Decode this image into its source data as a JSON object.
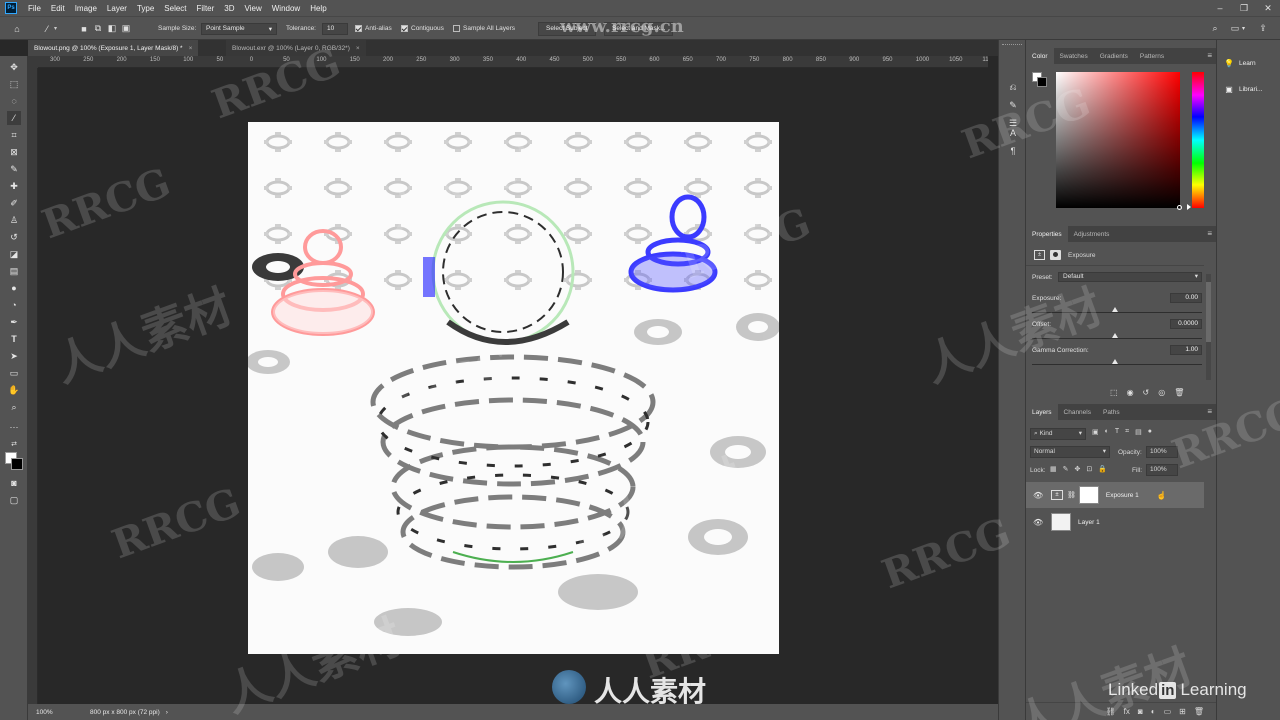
{
  "menubar": {
    "app_icon": "Ps",
    "items": [
      "File",
      "Edit",
      "Image",
      "Layer",
      "Type",
      "Select",
      "Filter",
      "3D",
      "View",
      "Window",
      "Help"
    ],
    "window_controls": [
      "minimize-icon",
      "maximize-icon",
      "close-icon"
    ]
  },
  "options": {
    "sample_size_label": "Sample Size:",
    "sample_size_value": "Point Sample",
    "tolerance_label": "Tolerance:",
    "tolerance_value": "10",
    "anti_alias_label": "Anti-alias",
    "contiguous_label": "Contiguous",
    "sample_all_layers_label": "Sample All Layers",
    "select_subject_label": "Select Subject",
    "select_and_mask_label": "Select and Mask...",
    "watermark_url": "www.rrcg.cn"
  },
  "tabs": [
    {
      "label": "Blowout.png @ 100% (Exposure 1, Layer Mask/8) *"
    },
    {
      "label": "Blowout.exr @ 100% (Layer 0, RGB/32*)"
    }
  ],
  "ruler_ticks": [
    "300",
    "250",
    "200",
    "150",
    "100",
    "50",
    "0",
    "50",
    "100",
    "150",
    "200",
    "250",
    "300",
    "350",
    "400",
    "450",
    "500",
    "550",
    "600",
    "650",
    "700",
    "750",
    "800",
    "850",
    "900",
    "950",
    "1000",
    "1050",
    "1100"
  ],
  "status": {
    "zoom": "100%",
    "doc_info": "800 px x 800 px (72 ppi)"
  },
  "color_panel": {
    "tabs": [
      "Color",
      "Swatches",
      "Gradients",
      "Patterns"
    ]
  },
  "properties_panel": {
    "tabs": [
      "Properties",
      "Adjustments"
    ],
    "adjustment_name": "Exposure",
    "preset_label": "Preset:",
    "preset_value": "Default",
    "exposure_label": "Exposure:",
    "exposure_value": "0.00",
    "offset_label": "Offset:",
    "offset_value": "0.0000",
    "gamma_label": "Gamma Correction:",
    "gamma_value": "1.00"
  },
  "layers_panel": {
    "tabs": [
      "Layers",
      "Channels",
      "Paths"
    ],
    "filter_label": "Kind",
    "blend_mode": "Normal",
    "opacity_label": "Opacity:",
    "opacity_value": "100%",
    "lock_label": "Lock:",
    "fill_label": "Fill:",
    "fill_value": "100%",
    "layers": [
      {
        "name": "Exposure 1",
        "selected": true
      },
      {
        "name": "Layer 1",
        "selected": false
      }
    ]
  },
  "libraries": {
    "items": [
      {
        "label": "Learn",
        "icon": "lightbulb-icon"
      },
      {
        "label": "Librari...",
        "icon": "libraries-icon"
      }
    ]
  },
  "watermarks": {
    "rrcg": "RRCG",
    "cn": "人人素材",
    "linkedin_word": "Linked",
    "linkedin_in": "in",
    "learning": "Learning"
  }
}
